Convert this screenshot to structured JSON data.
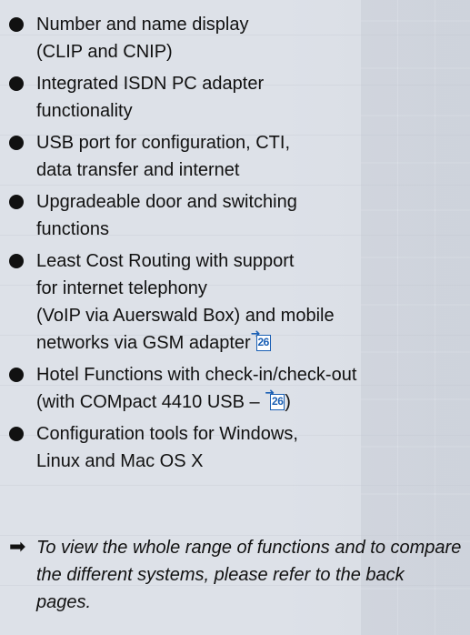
{
  "features": [
    {
      "lines": [
        "Number and name display",
        "(CLIP and CNIP)"
      ]
    },
    {
      "lines": [
        "Integrated ISDN PC adapter",
        "functionality"
      ]
    },
    {
      "lines": [
        "USB port for configuration, CTI,",
        "data transfer and internet"
      ]
    },
    {
      "lines": [
        "Upgradeable door and switching",
        "functions"
      ]
    },
    {
      "lines": [
        "Least Cost Routing with support",
        "for internet telephony",
        "(VoIP via Auerswald Box) and mobile",
        "networks via GSM adapter"
      ],
      "ref_page": "26"
    },
    {
      "lines": [
        "Hotel Functions with check-in/check-out",
        "(with COMpact 4410 USB – "
      ],
      "ref_page": "26",
      "ref_suffix": ")"
    },
    {
      "lines": [
        "Configuration tools for Windows,",
        "Linux and Mac OS X"
      ]
    }
  ],
  "note": {
    "arrow": "➡",
    "text": "To view the whole range of functions and to compare the different systems, please refer to the back pages."
  },
  "colors": {
    "accent": "#1a5fb4",
    "text": "#111111",
    "background": "#dde1e8"
  },
  "icons": {
    "bullet": "bullet-dot-icon",
    "reference": "page-reference-icon",
    "note": "right-arrow-icon"
  }
}
